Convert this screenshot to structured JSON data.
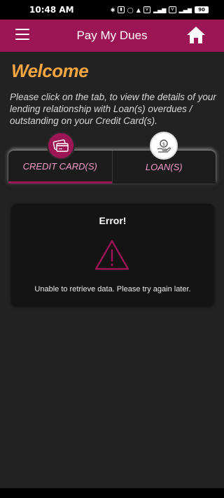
{
  "status_bar": {
    "time": "10:48 AM",
    "battery": "90"
  },
  "app_bar": {
    "title": "Pay My Dues"
  },
  "welcome": {
    "heading": "Welcome",
    "intro": "Please click on the tab, to view the details of your lending relationship with Loan(s) overdues / outstanding on your Credit Card(s)."
  },
  "tabs": [
    {
      "label": "CREDIT CARD(S)",
      "active": true
    },
    {
      "label": "LOAN(S)",
      "active": false
    }
  ],
  "error": {
    "title": "Error!",
    "message": "Unable to retrieve data. Please try again later."
  },
  "colors": {
    "brand": "#9c1555",
    "accent": "#f2a540",
    "tab_text": "#f39ac8",
    "background": "#222222"
  },
  "icons": {
    "menu": "hamburger-icon",
    "home": "home-icon",
    "credit_tab": "credit-card-icon",
    "loan_tab": "money-hand-icon",
    "error": "warning-triangle-icon"
  }
}
